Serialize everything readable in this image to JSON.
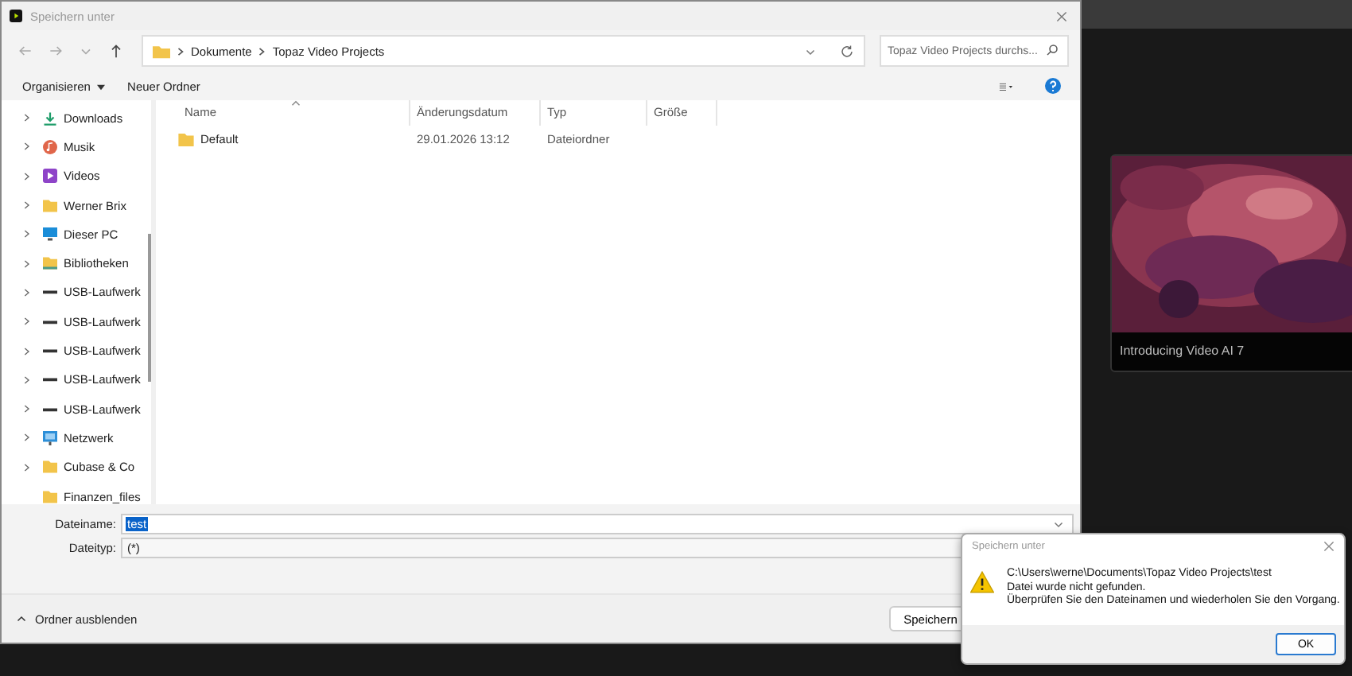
{
  "window": {
    "title": "Speichern unter"
  },
  "address": {
    "crumbs": [
      "Dokumente",
      "Topaz Video Projects"
    ]
  },
  "search": {
    "placeholder": "Topaz Video Projects durchs..."
  },
  "toolbar": {
    "organize": "Organisieren",
    "new_folder": "Neuer Ordner"
  },
  "sidebar": {
    "items": [
      {
        "label": "Downloads",
        "kind": "download",
        "expandable": true
      },
      {
        "label": "Musik",
        "kind": "music",
        "expandable": true
      },
      {
        "label": "Videos",
        "kind": "video",
        "expandable": true
      },
      {
        "label": "Werner Brix",
        "kind": "folder",
        "expandable": true
      },
      {
        "label": "Dieser PC",
        "kind": "pc",
        "expandable": true
      },
      {
        "label": "Bibliotheken",
        "kind": "library",
        "expandable": true
      },
      {
        "label": "USB-Laufwerk",
        "kind": "drive",
        "expandable": true
      },
      {
        "label": "USB-Laufwerk",
        "kind": "drive",
        "expandable": true
      },
      {
        "label": "USB-Laufwerk",
        "kind": "drive",
        "expandable": true
      },
      {
        "label": "USB-Laufwerk",
        "kind": "drive",
        "expandable": true
      },
      {
        "label": "USB-Laufwerk",
        "kind": "drive",
        "expandable": true
      },
      {
        "label": "Netzwerk",
        "kind": "network",
        "expandable": true
      },
      {
        "label": "Cubase & Co",
        "kind": "folder",
        "expandable": true
      },
      {
        "label": "Finanzen_files",
        "kind": "folder",
        "expandable": false
      }
    ]
  },
  "table": {
    "columns": [
      "Name",
      "Änderungsdatum",
      "Typ",
      "Größe"
    ],
    "rows": [
      {
        "name": "Default",
        "date": "29.01.2026 13:12",
        "type": "Dateiordner"
      }
    ]
  },
  "form": {
    "file_name_label": "Dateiname:",
    "file_name": {
      "value": "test",
      "selected": true
    },
    "file_type_label": "Dateityp:",
    "file_type": "(*)"
  },
  "footer": {
    "hide_folders": "Ordner ausblenden",
    "save": "Speichern"
  },
  "background_app": {
    "card": {
      "kind": "picture",
      "caption": "Introducing Video AI 7"
    }
  },
  "message_box": {
    "title": "Speichern unter",
    "lines": [
      "C:\\Users\\werne\\Documents\\Topaz Video Projects\\test",
      "Datei wurde nicht gefunden.",
      "Überprüfen Sie den Dateinamen und wiederholen Sie den Vorgang."
    ],
    "ok": "OK"
  }
}
